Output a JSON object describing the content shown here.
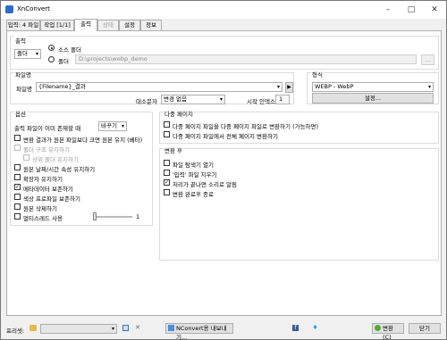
{
  "window": {
    "title": "XnConvert"
  },
  "tabs": [
    {
      "label": "입력: 4 파일"
    },
    {
      "label": "작업 [1/1]"
    },
    {
      "label": "출력"
    },
    {
      "label": "상태"
    },
    {
      "label": "설정"
    },
    {
      "label": "정보"
    }
  ],
  "output": {
    "title": "출력",
    "dest_combo": "폴더",
    "radio_source": "소스 폴더",
    "radio_folder": "폴더",
    "folder_path": "D:\\projects\\webp_demo",
    "browse": "..."
  },
  "filename": {
    "title": "파일명",
    "label": "파일명",
    "value": "{Filename}_결과",
    "case_label": "대소문자",
    "case_value": "변경 없음",
    "start_index_label": "시작 인덱스",
    "start_index_value": "1"
  },
  "format": {
    "title": "형식",
    "value": "WEBP - WebP",
    "settings": "설정..."
  },
  "options": {
    "title": "옵션",
    "exists_label": "출력 파일이 이미 존재할 때",
    "exists_value": "바꾸기",
    "items": [
      {
        "label": "변환 결과가 원본 파일보다 크면 원본 유지 (베타)",
        "checked": false,
        "disabled": false
      },
      {
        "label": "폴더 구조 유지하기",
        "checked": false,
        "disabled": true
      },
      {
        "label": "상위 폴더 유지하기",
        "checked": false,
        "disabled": true
      },
      {
        "label": "원본 날짜/시간 속성 유지하기",
        "checked": false,
        "disabled": false
      },
      {
        "label": "확장자 유지하기",
        "checked": false,
        "disabled": false
      },
      {
        "label": "메타데이터 보존하기",
        "checked": true,
        "disabled": false
      },
      {
        "label": "색상 프로파일 보존하기",
        "checked": false,
        "disabled": false
      },
      {
        "label": "원본 삭제하기",
        "checked": false,
        "disabled": false
      },
      {
        "label": "멀티스레드 사용",
        "checked": false,
        "disabled": false
      }
    ],
    "thread_value": "1"
  },
  "multipage": {
    "title": "다중 페이지",
    "items": [
      {
        "label": "다중 페이지 파일을 다중 페이지 파일로 변환하기 (가능하면)",
        "checked": false
      },
      {
        "label": "다중 페이지 파일에서 전체 페이지 변환하기",
        "checked": false
      }
    ]
  },
  "after": {
    "title": "변환 후",
    "items": [
      {
        "label": "파일 탐색기 열기",
        "checked": false
      },
      {
        "label": "'입력' 파일 지우기",
        "checked": false
      },
      {
        "label": "처리가 끝나면 소리로 알림",
        "checked": true
      },
      {
        "label": "변환 완료후 종료",
        "checked": false
      }
    ]
  },
  "bottom": {
    "preset_label": "프리셋:",
    "export": "NConvert용 내보내기...",
    "convert": "변환 (C)",
    "close": "닫기"
  },
  "colors": {
    "accent": "#2d6cc6",
    "tab_border": "#adadad",
    "group_border": "#dcdcdc"
  }
}
